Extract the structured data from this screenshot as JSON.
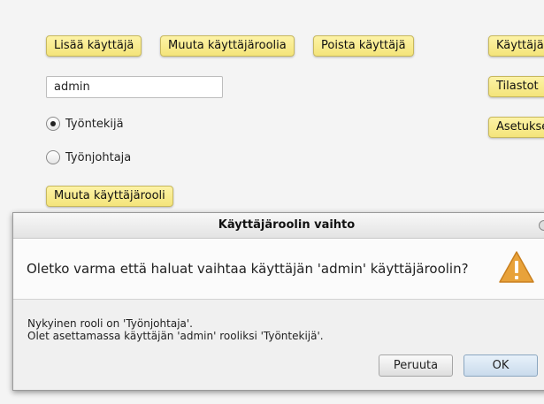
{
  "toolbar": {
    "add_user": "Lisää käyttäjä",
    "change_role": "Muuta käyttäjäroolia",
    "remove_user": "Poista käyttäjä"
  },
  "side_menu": {
    "users": "Käyttäjät",
    "statistics": "Tilastot",
    "settings": "Asetukset"
  },
  "form": {
    "username_value": "admin",
    "radio_employee": "Työntekijä",
    "radio_supervisor": "Työnjohtaja",
    "selected_role": "Työntekijä",
    "submit_label": "Muuta käyttäjärooli"
  },
  "dialog": {
    "title": "Käyttäjäroolin vaihto",
    "question": "Oletko varma että haluat vaihtaa käyttäjän 'admin' käyttäjäroolin?",
    "detail_line_1": "Nykyinen rooli on 'Työnjohtaja'.",
    "detail_line_2": "Olet asettamassa käyttäjän 'admin' rooliksi 'Työntekijä'.",
    "cancel_label": "Peruuta",
    "ok_label": "OK",
    "icon": "warning-icon"
  },
  "colors": {
    "button_yellow": "#f7e98a",
    "warning_orange": "#e8a23a"
  }
}
